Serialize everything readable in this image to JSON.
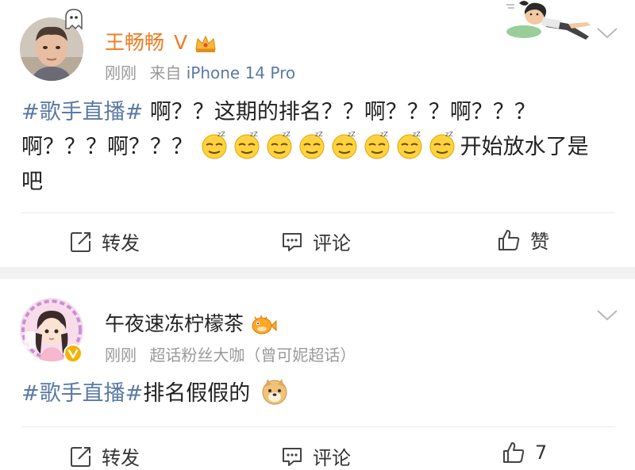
{
  "post1": {
    "user": {
      "name": "王畅畅",
      "level_mark": "V"
    },
    "meta": {
      "time": "刚刚",
      "source_prefix": "来自",
      "source": "iPhone 14 Pro"
    },
    "content": {
      "topic": "#歌手直播#",
      "line1_rest": " 啊？？这期的排名？？啊？？？啊？？？",
      "line2_text": "啊？？？啊？？？ ",
      "emoji_name": "sleepy-face-emoji",
      "emoji_count": 8,
      "line2_tail": "开始放水了是",
      "line3_text": "吧"
    },
    "actions": {
      "repost": "转发",
      "comment": "评论",
      "like": "赞"
    }
  },
  "post2": {
    "user": {
      "name": "午夜速冻柠檬茶"
    },
    "meta": {
      "time": "刚刚",
      "info": "超话粉丝大咖（曾可妮超话）"
    },
    "content": {
      "topic": "#歌手直播#",
      "rest": "排名假假的"
    },
    "actions": {
      "repost": "转发",
      "comment": "评论",
      "like_count": "7"
    }
  },
  "colors": {
    "name_orange": "#f07c21",
    "link_blue": "#5a7aa5",
    "meta_gray": "#9a9a9a",
    "verified_gold": "#f5b300",
    "separator_gray": "#f2f2f2"
  }
}
